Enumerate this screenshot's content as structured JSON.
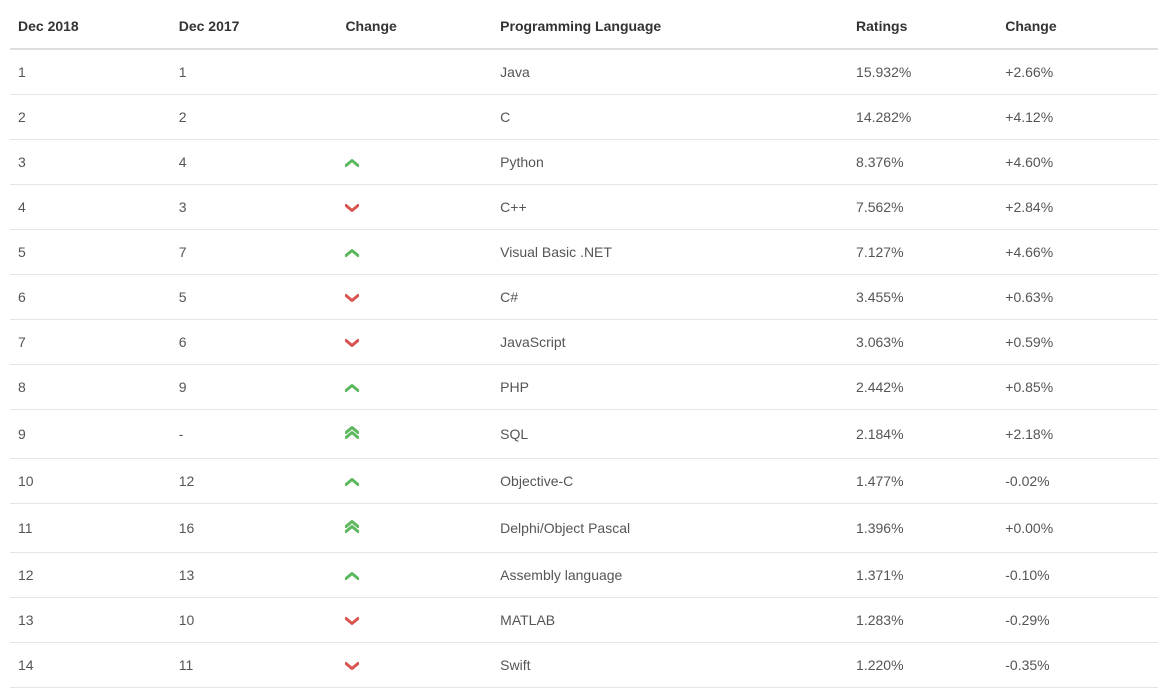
{
  "headers": {
    "dec2018": "Dec 2018",
    "dec2017": "Dec 2017",
    "change_icon": "Change",
    "language": "Programming Language",
    "ratings": "Ratings",
    "change_pct": "Change"
  },
  "rows": [
    {
      "dec2018": "1",
      "dec2017": "1",
      "change_dir": "none",
      "language": "Java",
      "ratings": "15.932%",
      "change_pct": "+2.66%"
    },
    {
      "dec2018": "2",
      "dec2017": "2",
      "change_dir": "none",
      "language": "C",
      "ratings": "14.282%",
      "change_pct": "+4.12%"
    },
    {
      "dec2018": "3",
      "dec2017": "4",
      "change_dir": "up",
      "language": "Python",
      "ratings": "8.376%",
      "change_pct": "+4.60%"
    },
    {
      "dec2018": "4",
      "dec2017": "3",
      "change_dir": "down",
      "language": "C++",
      "ratings": "7.562%",
      "change_pct": "+2.84%"
    },
    {
      "dec2018": "5",
      "dec2017": "7",
      "change_dir": "up",
      "language": "Visual Basic .NET",
      "ratings": "7.127%",
      "change_pct": "+4.66%"
    },
    {
      "dec2018": "6",
      "dec2017": "5",
      "change_dir": "down",
      "language": "C#",
      "ratings": "3.455%",
      "change_pct": "+0.63%"
    },
    {
      "dec2018": "7",
      "dec2017": "6",
      "change_dir": "down",
      "language": "JavaScript",
      "ratings": "3.063%",
      "change_pct": "+0.59%"
    },
    {
      "dec2018": "8",
      "dec2017": "9",
      "change_dir": "up",
      "language": "PHP",
      "ratings": "2.442%",
      "change_pct": "+0.85%"
    },
    {
      "dec2018": "9",
      "dec2017": "-",
      "change_dir": "double-up",
      "language": "SQL",
      "ratings": "2.184%",
      "change_pct": "+2.18%"
    },
    {
      "dec2018": "10",
      "dec2017": "12",
      "change_dir": "up",
      "language": "Objective-C",
      "ratings": "1.477%",
      "change_pct": "-0.02%"
    },
    {
      "dec2018": "11",
      "dec2017": "16",
      "change_dir": "double-up",
      "language": "Delphi/Object Pascal",
      "ratings": "1.396%",
      "change_pct": "+0.00%"
    },
    {
      "dec2018": "12",
      "dec2017": "13",
      "change_dir": "up",
      "language": "Assembly language",
      "ratings": "1.371%",
      "change_pct": "-0.10%"
    },
    {
      "dec2018": "13",
      "dec2017": "10",
      "change_dir": "down",
      "language": "MATLAB",
      "ratings": "1.283%",
      "change_pct": "-0.29%"
    },
    {
      "dec2018": "14",
      "dec2017": "11",
      "change_dir": "down",
      "language": "Swift",
      "ratings": "1.220%",
      "change_pct": "-0.35%"
    }
  ]
}
